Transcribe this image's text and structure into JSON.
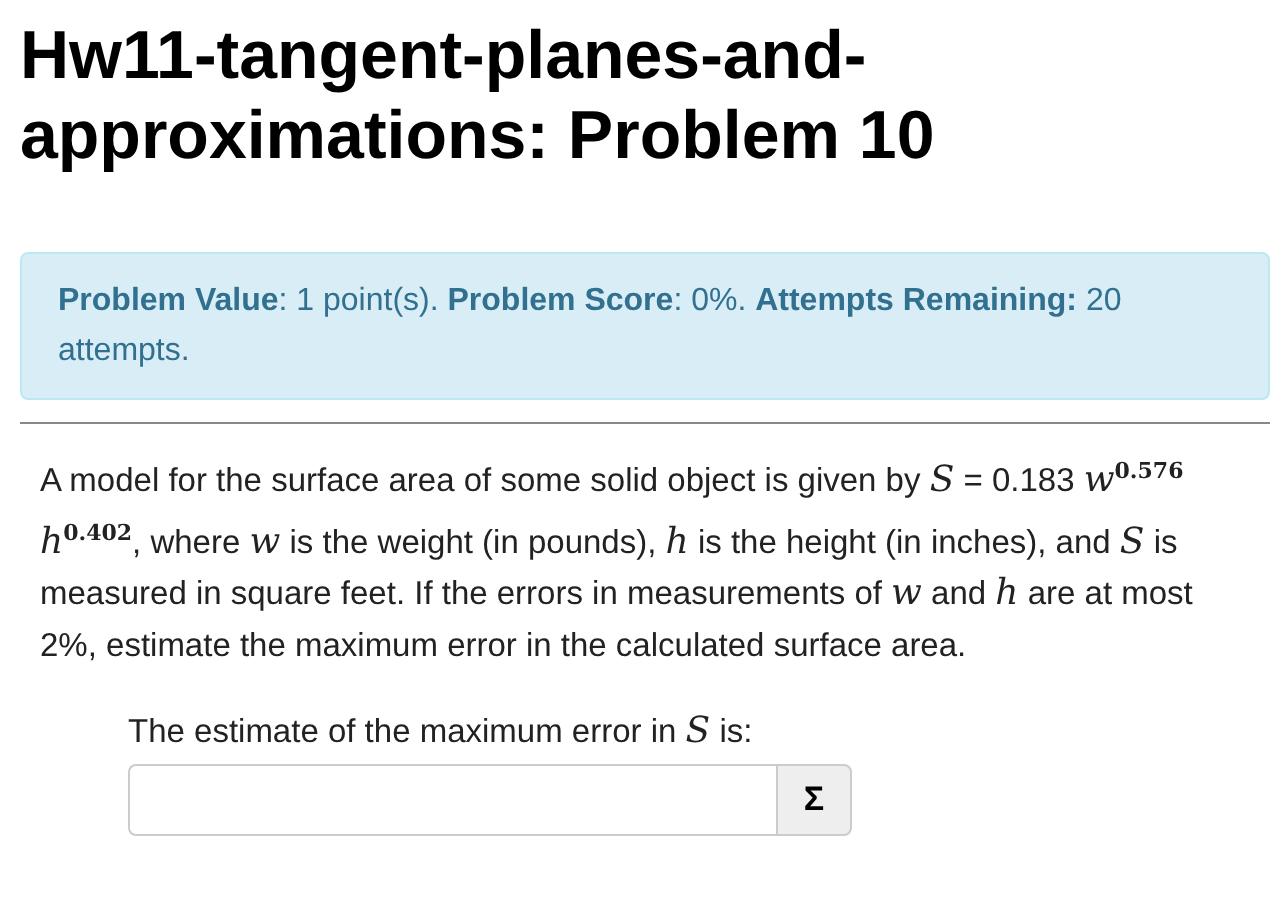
{
  "title": "Hw11-tangent-planes-and-approximations: Problem 10",
  "info": "**Problem Value**: 1 point(s). **Problem Score**: 0%. **Attempts Remaining:** 20 attempts.",
  "problem_text": "A model for the surface area of some solid object is given by *S* = 0.183 *w*$^{0.576}$ *h*$^{0.402}$, where *w* is the weight (in pounds), *h* is the height (in inches), and *S* is measured in square feet. If the errors in measurements of *w* and *h* are at most 2%, estimate the maximum error in the calculated surface area.",
  "answer": {
    "label": "The estimate of the maximum error in *S* is:",
    "button": "Σ"
  }
}
